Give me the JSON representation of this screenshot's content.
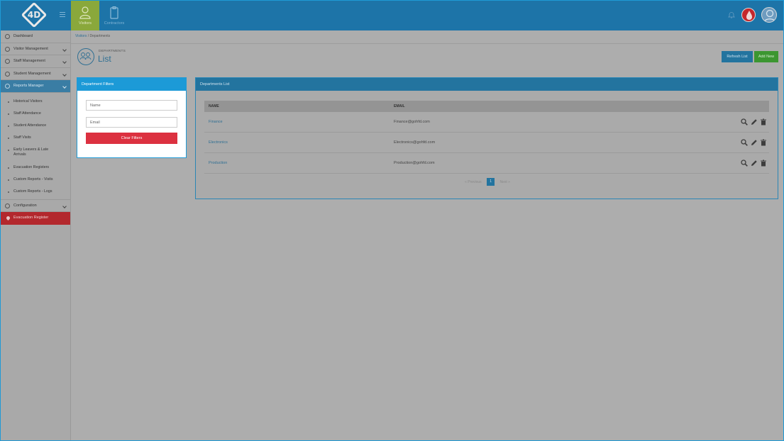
{
  "header": {
    "logo_text": "4D",
    "tabs": [
      {
        "label": "Visitors",
        "icon": "visitor-icon",
        "active": true
      },
      {
        "label": "Contractors",
        "icon": "clipboard-icon",
        "active": false
      }
    ],
    "icons": [
      "bell-icon",
      "blood-drop-icon",
      "user-avatar-icon"
    ]
  },
  "sidebar": {
    "items": [
      {
        "label": "Dashboard",
        "icon": "dashboard-icon"
      },
      {
        "label": "Visitor Management",
        "icon": "user-icon"
      },
      {
        "label": "Staff Management",
        "icon": "id-card-icon"
      },
      {
        "label": "Student Management",
        "icon": "student-icon"
      },
      {
        "label": "Reports Manager",
        "icon": "reports-icon"
      }
    ],
    "reports_submenu": [
      "Historical Visitors",
      "Staff Attendance",
      "Student Attendance",
      "Staff Visits",
      "Early Leavers & Late Arrivals",
      "Evacuation Registers",
      "Custom Reports - Visits",
      "Custom Reports - Logs"
    ],
    "configuration": "Configuration",
    "evacuation": "Evacuation Register"
  },
  "breadcrumb": {
    "root": "Visitors",
    "separator": "/",
    "current": "Departments"
  },
  "page": {
    "subtitle": "DEPARTMENTS",
    "title": "List",
    "refresh_label": "Refresh List",
    "add_label": "Add New"
  },
  "filters": {
    "title": "Department Filters",
    "name_placeholder": "Name",
    "email_placeholder": "Email",
    "clear_label": "Clear Filters"
  },
  "list": {
    "title": "Departments List",
    "columns": [
      "NAME",
      "EMAIL"
    ],
    "rows": [
      {
        "name": "Finance",
        "email": "Finance@gohfd.com"
      },
      {
        "name": "Electronics",
        "email": "Electronics@gohfd.com"
      },
      {
        "name": "Production",
        "email": "Production@gohfd.com"
      }
    ],
    "pager": {
      "prev": "« Previous",
      "page": "1",
      "next": "Next »"
    }
  },
  "colors": {
    "header": "#1d74a8",
    "active_tab": "#8aa83b",
    "filter_header": "#1c9ad7",
    "clear_button": "#dc3140",
    "add_button": "#3c9631",
    "evacuation": "#b3282d"
  }
}
